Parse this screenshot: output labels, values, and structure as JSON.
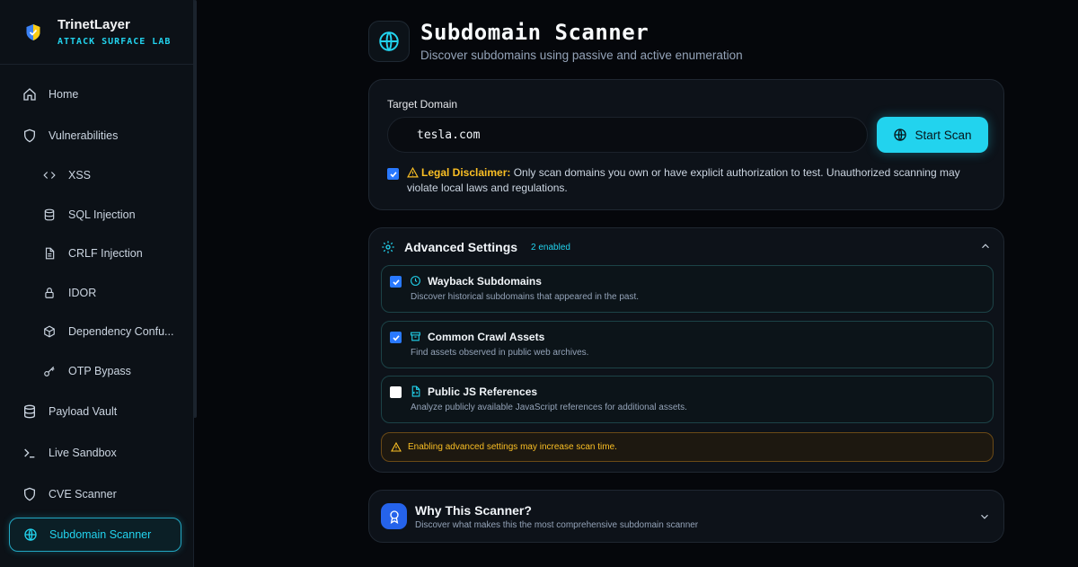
{
  "brand": {
    "name": "TrinetLayer",
    "subtitle": "ATTACK SURFACE LAB"
  },
  "sidebar": {
    "items": [
      {
        "label": "Home",
        "icon": "home-icon"
      },
      {
        "label": "Vulnerabilities",
        "icon": "shield-icon"
      },
      {
        "label": "XSS",
        "icon": "code-icon"
      },
      {
        "label": "SQL Injection",
        "icon": "database-icon"
      },
      {
        "label": "CRLF Injection",
        "icon": "file-icon"
      },
      {
        "label": "IDOR",
        "icon": "lock-icon"
      },
      {
        "label": "Dependency Confu...",
        "icon": "package-icon"
      },
      {
        "label": "OTP Bypass",
        "icon": "key-icon"
      },
      {
        "label": "Payload Vault",
        "icon": "database-icon"
      },
      {
        "label": "Live Sandbox",
        "icon": "terminal-icon"
      },
      {
        "label": "CVE Scanner",
        "icon": "shield-icon"
      },
      {
        "label": "Subdomain Scanner",
        "icon": "globe-icon",
        "active": true
      }
    ]
  },
  "header": {
    "title": "Subdomain Scanner",
    "description": "Discover subdomains using passive and active enumeration"
  },
  "target": {
    "label": "Target Domain",
    "value": "tesla.com",
    "scan_button": "Start Scan",
    "disclaimer_checked": true,
    "disclaimer_title": "Legal Disclaimer:",
    "disclaimer_text": "Only scan domains you own or have explicit authorization to test. Unauthorized scanning may violate local laws and regulations."
  },
  "advanced": {
    "title": "Advanced Settings",
    "badge": "2 enabled",
    "options": [
      {
        "title": "Wayback Subdomains",
        "description": "Discover historical subdomains that appeared in the past.",
        "checked": true,
        "icon": "clock-icon"
      },
      {
        "title": "Common Crawl Assets",
        "description": "Find assets observed in public web archives.",
        "checked": true,
        "icon": "archive-icon"
      },
      {
        "title": "Public JS References",
        "description": "Analyze publicly available JavaScript references for additional assets.",
        "checked": false,
        "icon": "file-code-icon"
      }
    ],
    "note": "Enabling advanced settings may increase scan time."
  },
  "why": {
    "title": "Why This Scanner?",
    "description": "Discover what makes this the most comprehensive subdomain scanner"
  },
  "colors": {
    "accent": "#22d3ee",
    "warning": "#fbbf24",
    "checkbox": "#2979ff"
  }
}
